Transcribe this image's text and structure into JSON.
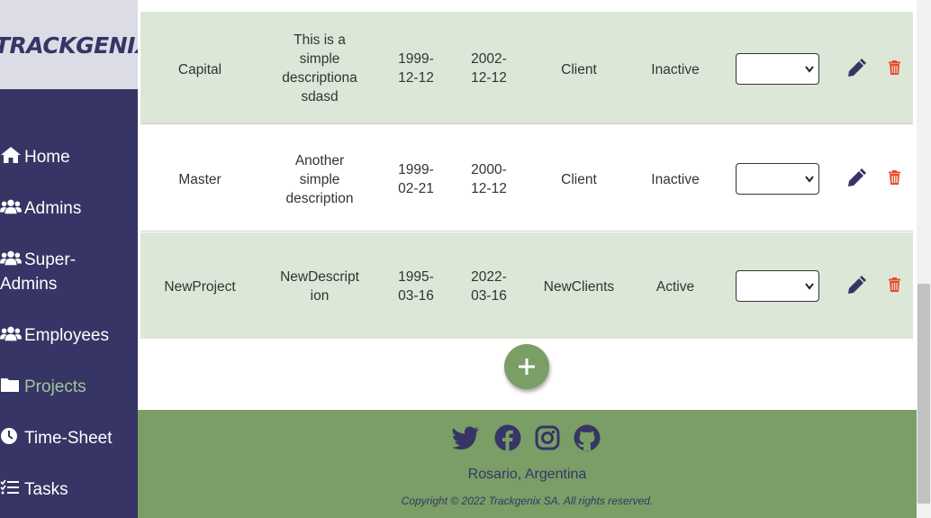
{
  "brand": {
    "logo_text": "TRACKGENIX"
  },
  "sidebar": {
    "items": [
      {
        "label": "Home",
        "icon": "home-icon"
      },
      {
        "label": "Admins",
        "icon": "users-icon"
      },
      {
        "label": "Super-Admins",
        "line1": "Super-",
        "line2": "Admins",
        "icon": "users-icon"
      },
      {
        "label": "Employees",
        "icon": "users-icon"
      },
      {
        "label": "Projects",
        "icon": "folder-icon",
        "active": true
      },
      {
        "label": "Time-Sheet",
        "icon": "clock-icon"
      },
      {
        "label": "Tasks",
        "icon": "tasks-icon"
      }
    ]
  },
  "table": {
    "rows": [
      {
        "name": "Capital",
        "description_lines": [
          "This is a",
          "simple",
          "descriptiona",
          "sdasd"
        ],
        "start_date_lines": [
          "1999-",
          "12-12"
        ],
        "end_date_lines": [
          "2002-",
          "12-12"
        ],
        "client": "Client",
        "status": "Inactive",
        "select_value": ""
      },
      {
        "name": "Master",
        "description_lines": [
          "Another",
          "simple",
          "description"
        ],
        "start_date_lines": [
          "1999-",
          "02-21"
        ],
        "end_date_lines": [
          "2000-",
          "12-12"
        ],
        "client": "Client",
        "status": "Inactive",
        "select_value": ""
      },
      {
        "name": "NewProject",
        "description_lines": [
          "NewDescript",
          "ion"
        ],
        "start_date_lines": [
          "1995-",
          "03-16"
        ],
        "end_date_lines": [
          "2022-",
          "03-16"
        ],
        "client": "NewClients",
        "status": "Active",
        "select_value": ""
      }
    ]
  },
  "footer": {
    "social": [
      "twitter-icon",
      "facebook-icon",
      "instagram-icon",
      "github-icon"
    ],
    "location": "Rosario, Argentina",
    "copyright": "Copyright © 2022 Trackgenix SA. All rights reserved."
  },
  "colors": {
    "sidebar_bg": "#363565",
    "active_nav": "#a3c596",
    "row_green": "#dce7d8",
    "footer_bg": "#7a9e66",
    "edit_icon": "#363565",
    "delete_icon": "#e74c2c"
  }
}
